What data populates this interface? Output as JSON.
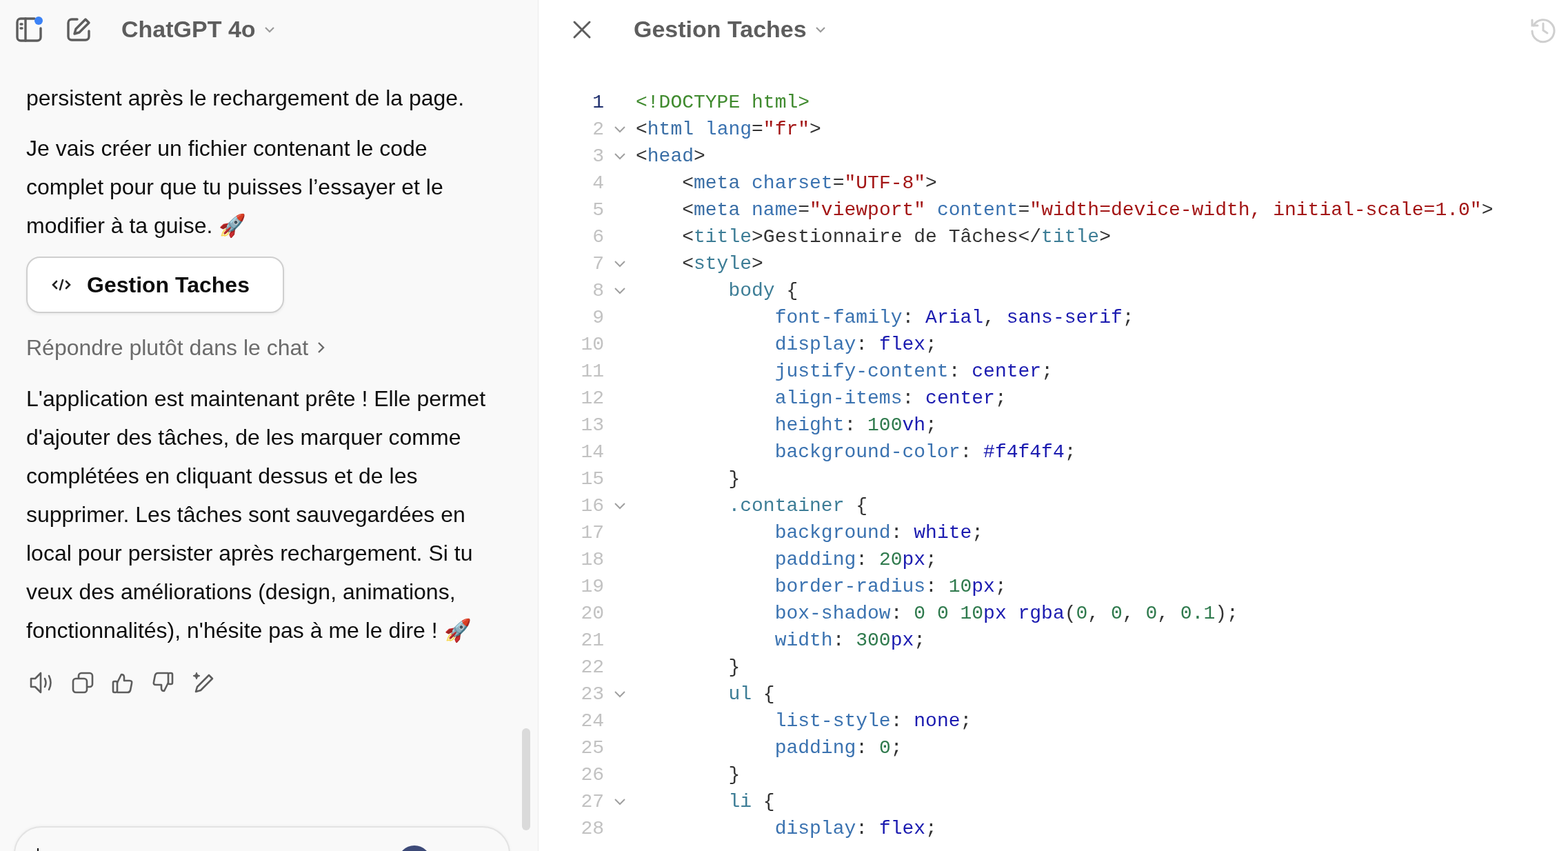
{
  "header": {
    "title": "ChatGPT 4o",
    "sidebar_unread": true
  },
  "messages": [
    {
      "kind": "text",
      "text": "persistent après le rechargement de la page."
    },
    {
      "kind": "text",
      "text": "Je vais créer un fichier contenant le code complet pour que tu puisses l’essayer et le modifier à ta guise. 🚀"
    },
    {
      "kind": "canvas",
      "label": "Gestion Taches"
    },
    {
      "kind": "link",
      "text": "Répondre plutôt dans le chat"
    },
    {
      "kind": "text",
      "text": "L'application est maintenant prête ! Elle permet d'ajouter des tâches, de les marquer comme complétées en cliquant dessus et de les supprimer. Les tâches sont sauvegardées en local pour persister après rechargement. Si tu veux des améliorations (design, animations, fonctionnalités), n'hésite pas à me le dire ! 🚀"
    }
  ],
  "editor": {
    "title": "Gestion Taches",
    "lines": [
      {
        "number": "1",
        "fold": false,
        "current": true,
        "tokens": [
          {
            "kind": "doctype",
            "text": "<!DOCTYPE html>"
          }
        ]
      },
      {
        "number": "2",
        "fold": true,
        "current": false,
        "tokens": [
          {
            "kind": "punct",
            "text": "<"
          },
          {
            "kind": "tag",
            "text": "html"
          },
          {
            "kind": "attr",
            "text": " lang"
          },
          {
            "kind": "punct",
            "text": "="
          },
          {
            "kind": "string",
            "text": "\"fr\""
          },
          {
            "kind": "punct",
            "text": ">"
          }
        ]
      },
      {
        "number": "3",
        "fold": true,
        "current": false,
        "tokens": [
          {
            "kind": "punct",
            "text": "<"
          },
          {
            "kind": "tag",
            "text": "head"
          },
          {
            "kind": "punct",
            "text": ">"
          }
        ]
      },
      {
        "number": "4",
        "fold": false,
        "current": false,
        "tokens": [
          {
            "kind": "punct",
            "text": "    <"
          },
          {
            "kind": "tag",
            "text": "meta"
          },
          {
            "kind": "attr",
            "text": " charset"
          },
          {
            "kind": "punct",
            "text": "="
          },
          {
            "kind": "string",
            "text": "\"UTF-8\""
          },
          {
            "kind": "punct",
            "text": ">"
          }
        ]
      },
      {
        "number": "5",
        "fold": false,
        "current": false,
        "tokens": [
          {
            "kind": "punct",
            "text": "    <"
          },
          {
            "kind": "tag",
            "text": "meta"
          },
          {
            "kind": "attr",
            "text": " name"
          },
          {
            "kind": "punct",
            "text": "="
          },
          {
            "kind": "string",
            "text": "\"viewport\""
          },
          {
            "kind": "attr",
            "text": " content"
          },
          {
            "kind": "punct",
            "text": "="
          },
          {
            "kind": "string",
            "text": "\"width=device-width, initial-scale=1.0\""
          },
          {
            "kind": "punct",
            "text": ">"
          }
        ]
      },
      {
        "number": "6",
        "fold": false,
        "current": false,
        "tokens": [
          {
            "kind": "punct",
            "text": "    <"
          },
          {
            "kind": "tag2",
            "text": "title"
          },
          {
            "kind": "punct",
            "text": ">Gestionnaire de Tâches</"
          },
          {
            "kind": "tag2",
            "text": "title"
          },
          {
            "kind": "punct",
            "text": ">"
          }
        ]
      },
      {
        "number": "7",
        "fold": true,
        "current": false,
        "tokens": [
          {
            "kind": "punct",
            "text": "    <"
          },
          {
            "kind": "tag2",
            "text": "style"
          },
          {
            "kind": "punct",
            "text": ">"
          }
        ]
      },
      {
        "number": "8",
        "fold": true,
        "current": false,
        "tokens": [
          {
            "kind": "selector",
            "text": "        body"
          },
          {
            "kind": "punct",
            "text": " {"
          }
        ]
      },
      {
        "number": "9",
        "fold": false,
        "current": false,
        "tokens": [
          {
            "kind": "property",
            "text": "            font-family"
          },
          {
            "kind": "punct",
            "text": ": "
          },
          {
            "kind": "keyword",
            "text": "Arial"
          },
          {
            "kind": "punct",
            "text": ", "
          },
          {
            "kind": "keyword",
            "text": "sans-serif"
          },
          {
            "kind": "punct",
            "text": ";"
          }
        ]
      },
      {
        "number": "10",
        "fold": false,
        "current": false,
        "tokens": [
          {
            "kind": "property",
            "text": "            display"
          },
          {
            "kind": "punct",
            "text": ": "
          },
          {
            "kind": "keyword",
            "text": "flex"
          },
          {
            "kind": "punct",
            "text": ";"
          }
        ]
      },
      {
        "number": "11",
        "fold": false,
        "current": false,
        "tokens": [
          {
            "kind": "property",
            "text": "            justify-content"
          },
          {
            "kind": "punct",
            "text": ": "
          },
          {
            "kind": "keyword",
            "text": "center"
          },
          {
            "kind": "punct",
            "text": ";"
          }
        ]
      },
      {
        "number": "12",
        "fold": false,
        "current": false,
        "tokens": [
          {
            "kind": "property",
            "text": "            align-items"
          },
          {
            "kind": "punct",
            "text": ": "
          },
          {
            "kind": "keyword",
            "text": "center"
          },
          {
            "kind": "punct",
            "text": ";"
          }
        ]
      },
      {
        "number": "13",
        "fold": false,
        "current": false,
        "tokens": [
          {
            "kind": "property",
            "text": "            height"
          },
          {
            "kind": "punct",
            "text": ": "
          },
          {
            "kind": "number",
            "text": "100"
          },
          {
            "kind": "keyword",
            "text": "vh"
          },
          {
            "kind": "punct",
            "text": ";"
          }
        ]
      },
      {
        "number": "14",
        "fold": false,
        "current": false,
        "tokens": [
          {
            "kind": "property",
            "text": "            background-color"
          },
          {
            "kind": "punct",
            "text": ": "
          },
          {
            "kind": "keyword",
            "text": "#f4f4f4"
          },
          {
            "kind": "punct",
            "text": ";"
          }
        ]
      },
      {
        "number": "15",
        "fold": false,
        "current": false,
        "tokens": [
          {
            "kind": "punct",
            "text": "        }"
          }
        ]
      },
      {
        "number": "16",
        "fold": true,
        "current": false,
        "tokens": [
          {
            "kind": "selector",
            "text": "        .container"
          },
          {
            "kind": "punct",
            "text": " {"
          }
        ]
      },
      {
        "number": "17",
        "fold": false,
        "current": false,
        "tokens": [
          {
            "kind": "property",
            "text": "            background"
          },
          {
            "kind": "punct",
            "text": ": "
          },
          {
            "kind": "keyword",
            "text": "white"
          },
          {
            "kind": "punct",
            "text": ";"
          }
        ]
      },
      {
        "number": "18",
        "fold": false,
        "current": false,
        "tokens": [
          {
            "kind": "property",
            "text": "            padding"
          },
          {
            "kind": "punct",
            "text": ": "
          },
          {
            "kind": "number",
            "text": "20"
          },
          {
            "kind": "keyword",
            "text": "px"
          },
          {
            "kind": "punct",
            "text": ";"
          }
        ]
      },
      {
        "number": "19",
        "fold": false,
        "current": false,
        "tokens": [
          {
            "kind": "property",
            "text": "            border-radius"
          },
          {
            "kind": "punct",
            "text": ": "
          },
          {
            "kind": "number",
            "text": "10"
          },
          {
            "kind": "keyword",
            "text": "px"
          },
          {
            "kind": "punct",
            "text": ";"
          }
        ]
      },
      {
        "number": "20",
        "fold": false,
        "current": false,
        "tokens": [
          {
            "kind": "property",
            "text": "            box-shadow"
          },
          {
            "kind": "punct",
            "text": ": "
          },
          {
            "kind": "number",
            "text": "0 0 10"
          },
          {
            "kind": "keyword",
            "text": "px rgba"
          },
          {
            "kind": "punct",
            "text": "("
          },
          {
            "kind": "number",
            "text": "0"
          },
          {
            "kind": "punct",
            "text": ", "
          },
          {
            "kind": "number",
            "text": "0"
          },
          {
            "kind": "punct",
            "text": ", "
          },
          {
            "kind": "number",
            "text": "0"
          },
          {
            "kind": "punct",
            "text": ", "
          },
          {
            "kind": "number",
            "text": "0.1"
          },
          {
            "kind": "punct",
            "text": ");"
          }
        ]
      },
      {
        "number": "21",
        "fold": false,
        "current": false,
        "tokens": [
          {
            "kind": "property",
            "text": "            width"
          },
          {
            "kind": "punct",
            "text": ": "
          },
          {
            "kind": "number",
            "text": "300"
          },
          {
            "kind": "keyword",
            "text": "px"
          },
          {
            "kind": "punct",
            "text": ";"
          }
        ]
      },
      {
        "number": "22",
        "fold": false,
        "current": false,
        "tokens": [
          {
            "kind": "punct",
            "text": "        }"
          }
        ]
      },
      {
        "number": "23",
        "fold": true,
        "current": false,
        "tokens": [
          {
            "kind": "selector",
            "text": "        ul"
          },
          {
            "kind": "punct",
            "text": " {"
          }
        ]
      },
      {
        "number": "24",
        "fold": false,
        "current": false,
        "tokens": [
          {
            "kind": "property",
            "text": "            list-style"
          },
          {
            "kind": "punct",
            "text": ": "
          },
          {
            "kind": "keyword",
            "text": "none"
          },
          {
            "kind": "punct",
            "text": ";"
          }
        ]
      },
      {
        "number": "25",
        "fold": false,
        "current": false,
        "tokens": [
          {
            "kind": "property",
            "text": "            padding"
          },
          {
            "kind": "punct",
            "text": ": "
          },
          {
            "kind": "number",
            "text": "0"
          },
          {
            "kind": "punct",
            "text": ";"
          }
        ]
      },
      {
        "number": "26",
        "fold": false,
        "current": false,
        "tokens": [
          {
            "kind": "punct",
            "text": "        }"
          }
        ]
      },
      {
        "number": "27",
        "fold": true,
        "current": false,
        "tokens": [
          {
            "kind": "selector",
            "text": "        li"
          },
          {
            "kind": "punct",
            "text": " {"
          }
        ]
      },
      {
        "number": "28",
        "fold": false,
        "current": false,
        "tokens": [
          {
            "kind": "property",
            "text": "            display"
          },
          {
            "kind": "punct",
            "text": ": "
          },
          {
            "kind": "keyword",
            "text": "flex"
          },
          {
            "kind": "punct",
            "text": ";"
          }
        ]
      }
    ]
  }
}
